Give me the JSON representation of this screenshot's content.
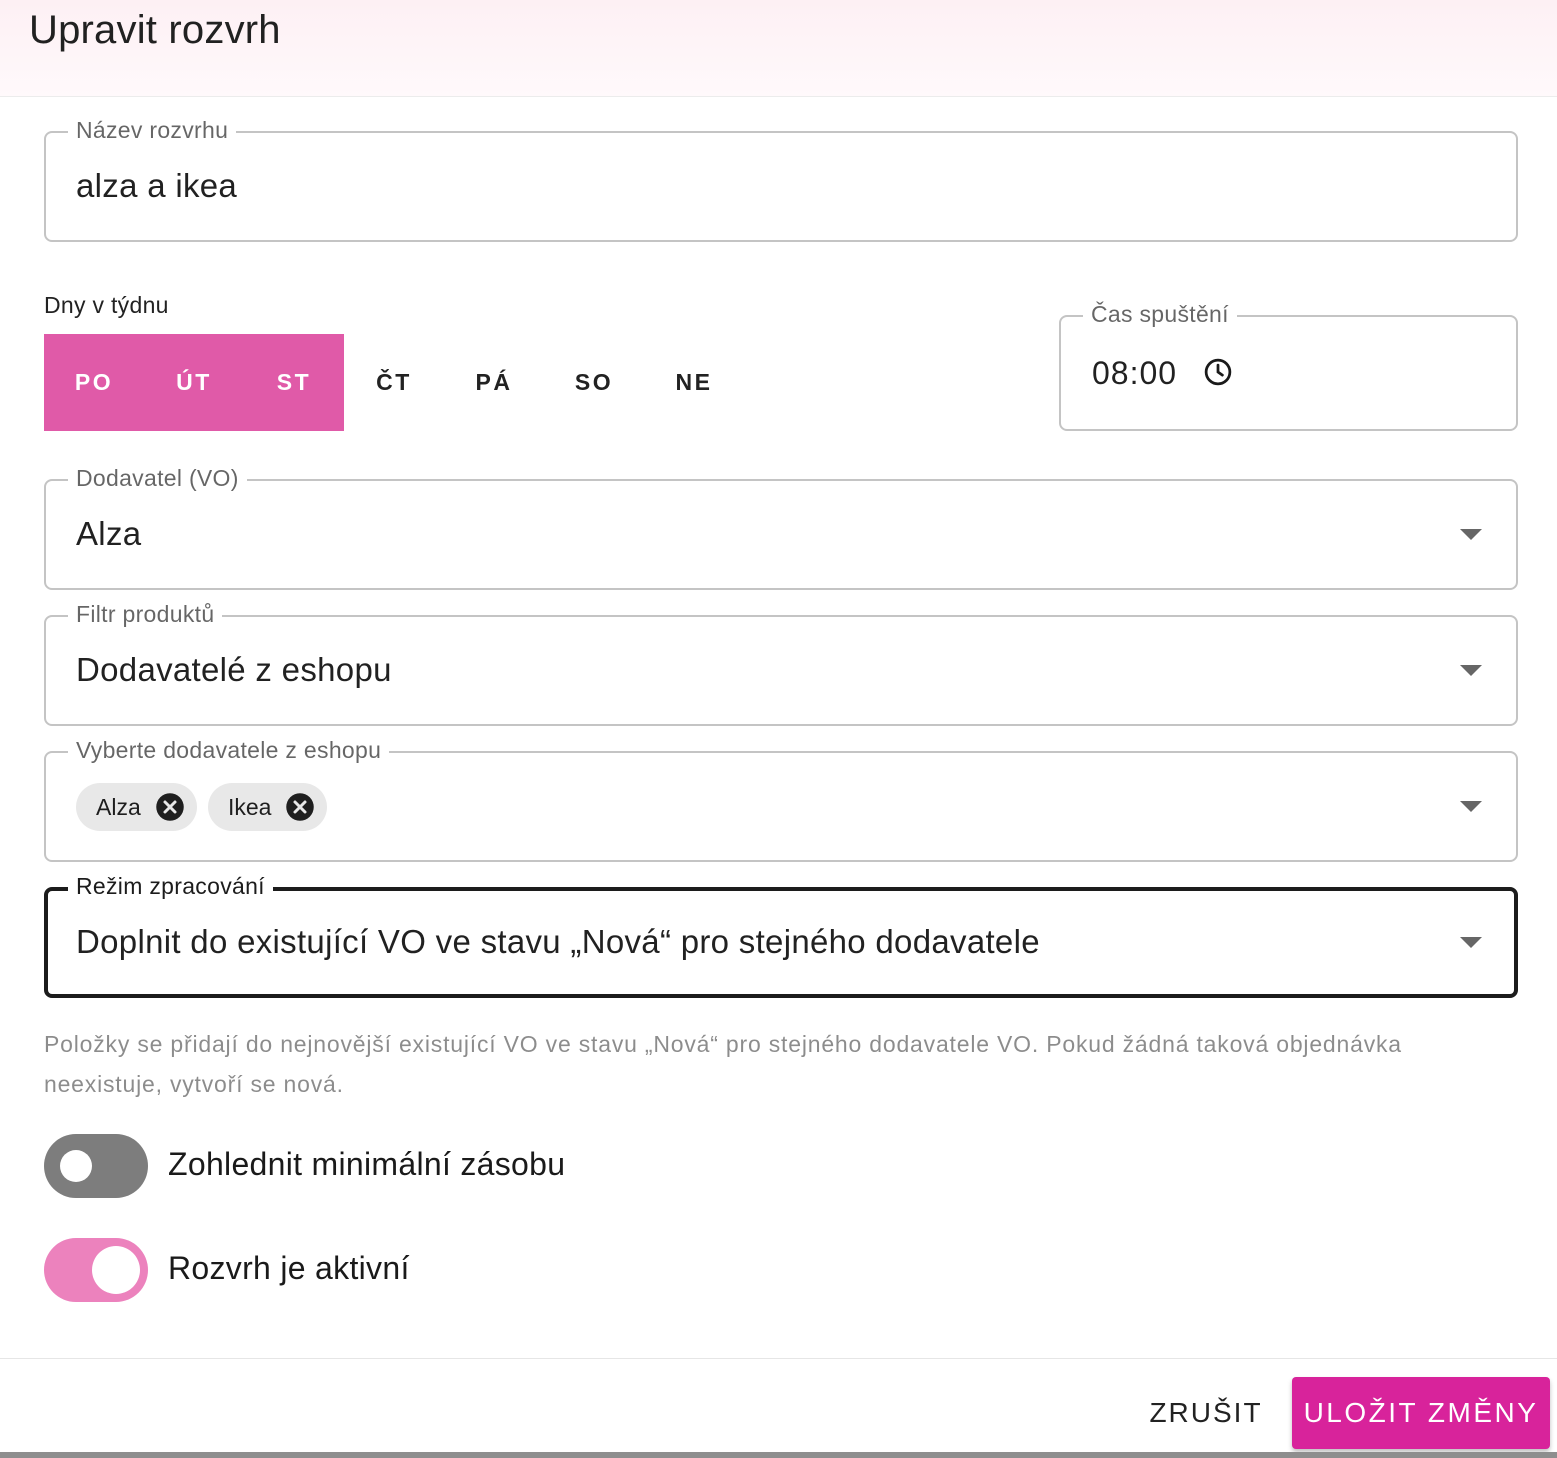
{
  "dialog": {
    "title": "Upravit rozvrh"
  },
  "name_field": {
    "label": "Název rozvrhu",
    "value": "alza a ikea"
  },
  "days": {
    "label": "Dny v týdnu",
    "items": [
      {
        "label": "PO",
        "selected": true
      },
      {
        "label": "ÚT",
        "selected": true
      },
      {
        "label": "ST",
        "selected": true
      },
      {
        "label": "ČT",
        "selected": false
      },
      {
        "label": "PÁ",
        "selected": false
      },
      {
        "label": "SO",
        "selected": false
      },
      {
        "label": "NE",
        "selected": false
      }
    ]
  },
  "time_field": {
    "label": "Čas spuštění",
    "value": "08:00",
    "icon": "clock-icon"
  },
  "supplier_field": {
    "label": "Dodavatel (VO)",
    "value": "Alza"
  },
  "filter_field": {
    "label": "Filtr produktů",
    "value": "Dodavatelé z eshopu"
  },
  "eshop_suppliers_field": {
    "label": "Vyberte dodavatele z eshopu",
    "chips": [
      {
        "label": "Alza"
      },
      {
        "label": "Ikea"
      }
    ]
  },
  "mode_field": {
    "label": "Režim zpracování",
    "value": "Doplnit do existující VO ve stavu „Nová“ pro stejného dodavatele"
  },
  "helper_text": "Položky se přidají do nejnovější existující VO ve stavu „Nová“ pro stejného dodavatele VO. Pokud žádná taková objednávka neexistuje, vytvoří se nová.",
  "toggles": {
    "min_stock": {
      "label": "Zohlednit minimální zásobu",
      "checked": false
    },
    "active": {
      "label": "Rozvrh je aktivní",
      "checked": true
    }
  },
  "footer": {
    "cancel_label": "ZRUŠIT",
    "save_label": "ULOŽIT ZMĚNY"
  },
  "colors": {
    "accent": "#d8239b",
    "day_selected": "#e05aa8",
    "toggle_on": "#ec82bd"
  }
}
